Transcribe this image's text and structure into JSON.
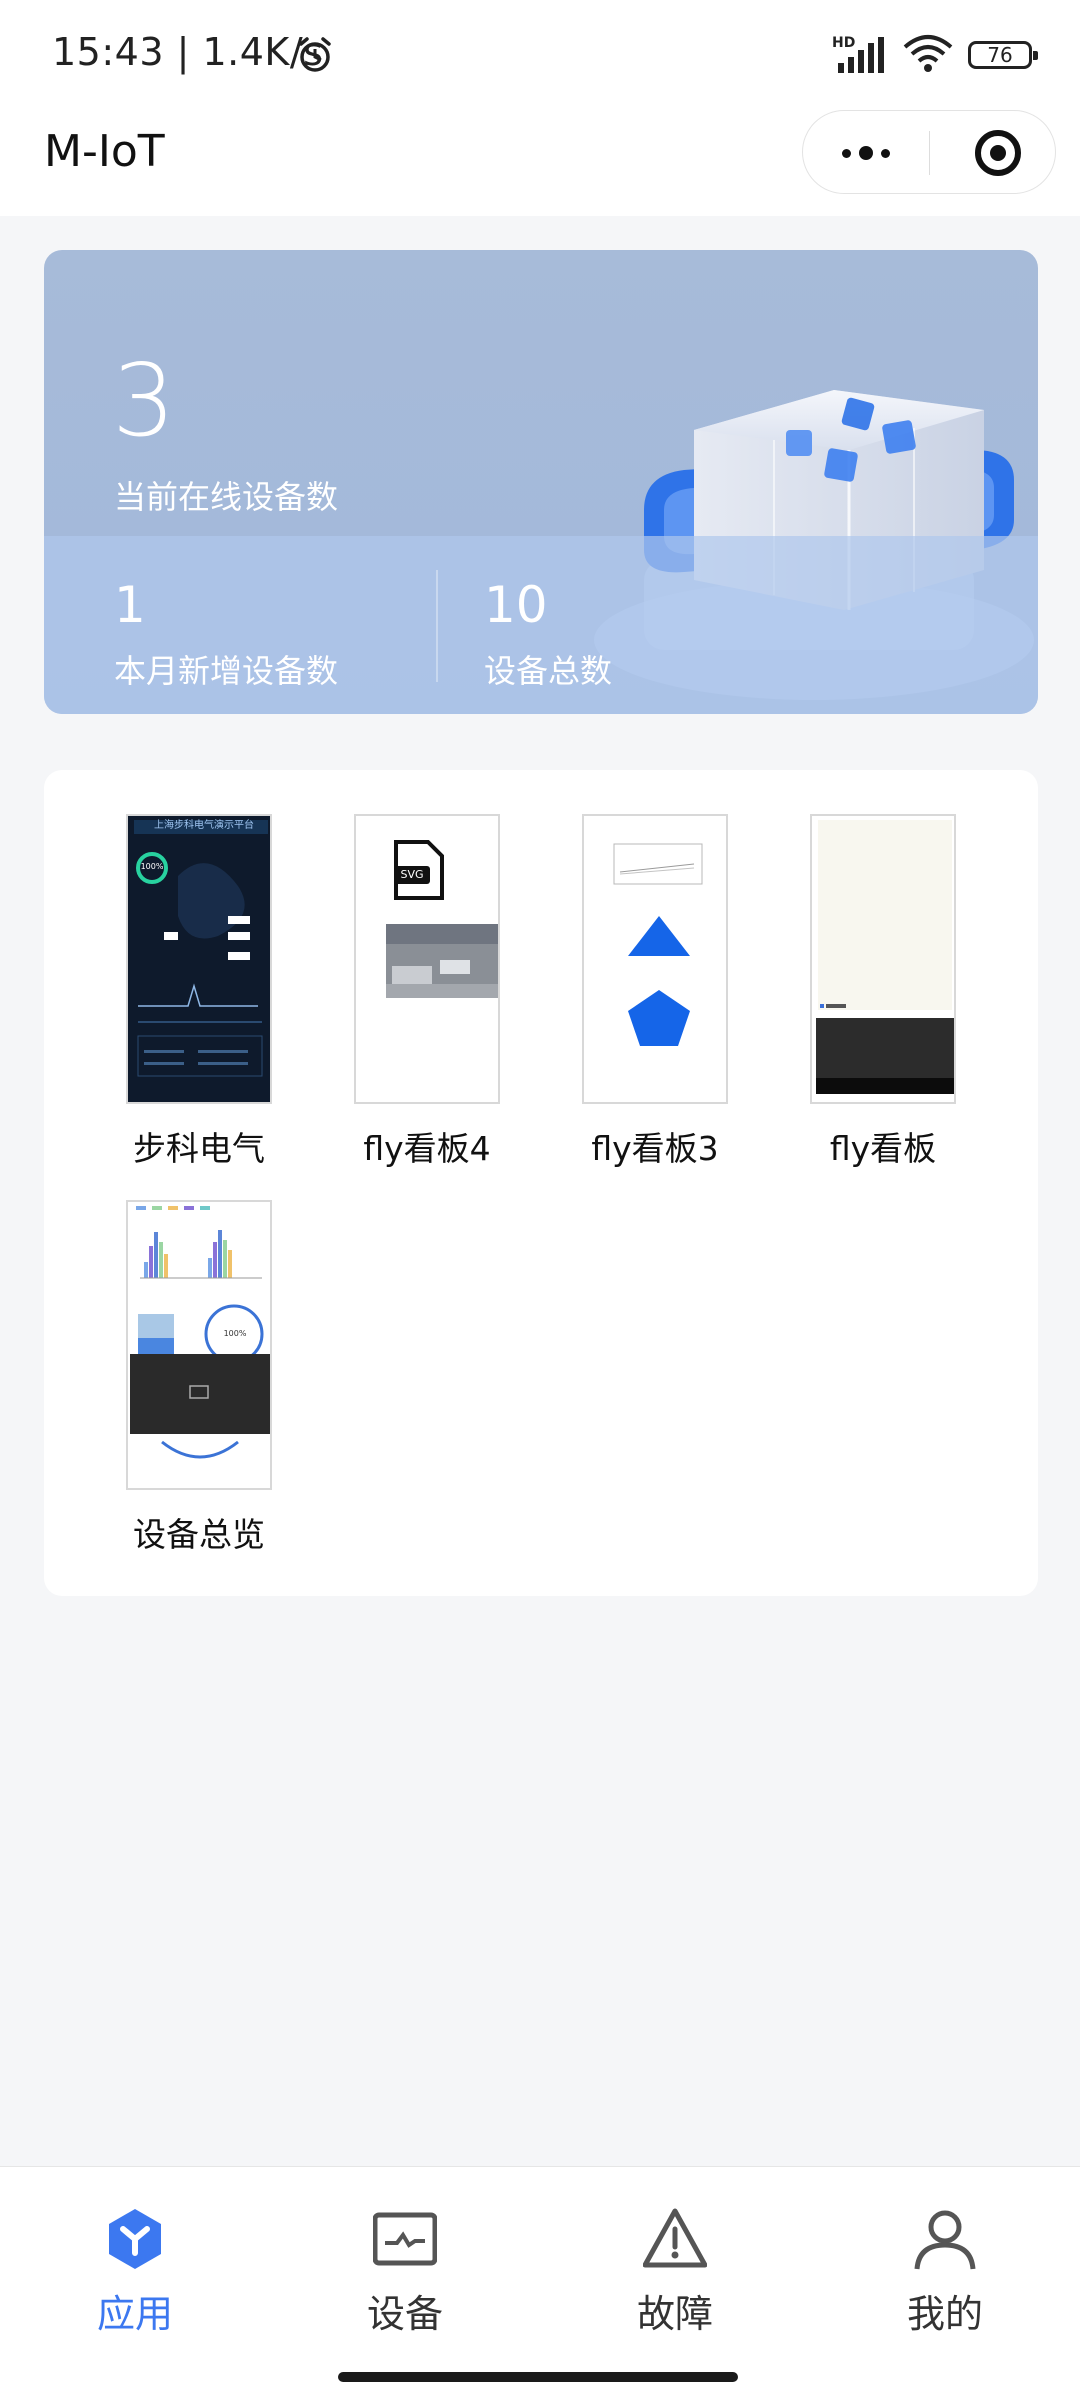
{
  "status_bar": {
    "time_speed": "15:43 | 1.4K/s",
    "network": "HD",
    "battery": "76"
  },
  "nav": {
    "title": "M-IoT"
  },
  "stats": {
    "online_count": "3",
    "online_label": "当前在线设备数",
    "new_count": "1",
    "new_label": "本月新增设备数",
    "total_count": "10",
    "total_label": "设备总数"
  },
  "apps": [
    {
      "label": "步科电气",
      "thumb_header": "上海步科电气演示平台",
      "thumb_gauge": "100%"
    },
    {
      "label": "fly看板4",
      "thumb_badge": "SVG"
    },
    {
      "label": "fly看板3"
    },
    {
      "label": "fly看板"
    },
    {
      "label": "设备总览",
      "thumb_gauge": "100%"
    }
  ],
  "tabs": [
    {
      "label": "应用",
      "icon": "apps-icon",
      "active": true
    },
    {
      "label": "设备",
      "icon": "device-monitor-icon",
      "active": false
    },
    {
      "label": "故障",
      "icon": "warning-icon",
      "active": false
    },
    {
      "label": "我的",
      "icon": "user-icon",
      "active": false
    }
  ],
  "colors": {
    "accent": "#3c78f0",
    "card_blue": "#a7bbd9",
    "background": "#f5f6f8"
  }
}
